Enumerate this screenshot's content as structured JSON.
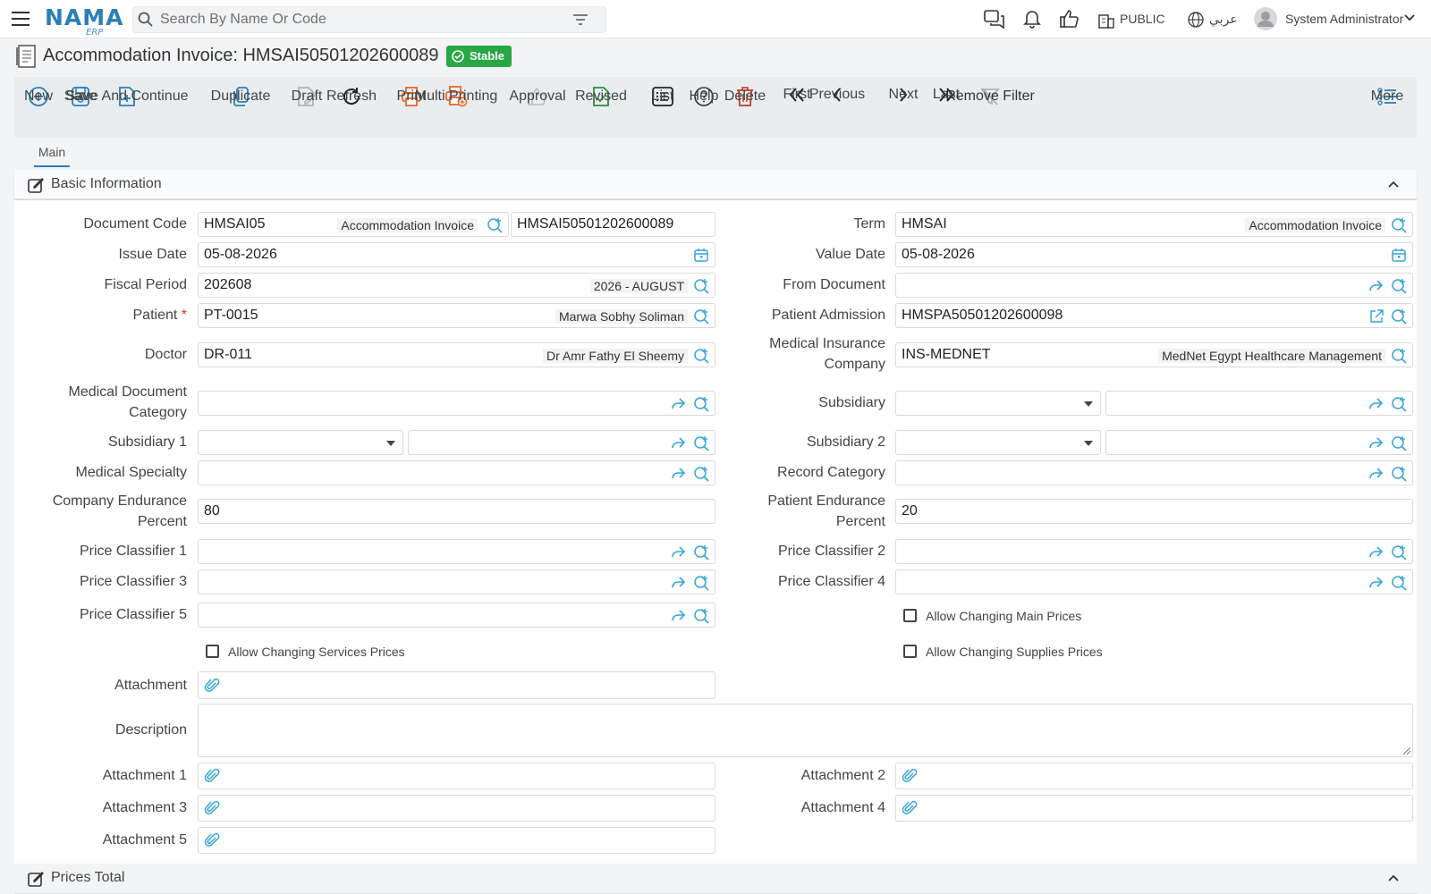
{
  "app": {
    "logo": "NAMA",
    "logo_sub": "ERP"
  },
  "search": {
    "placeholder": "Search By Name Or Code"
  },
  "header": {
    "branch": "PUBLIC",
    "language": "عربي",
    "user": "System Administrator"
  },
  "page": {
    "title": "Accommodation Invoice: HMSAI50501202600089",
    "status": "Stable"
  },
  "toolbar": {
    "new": "New",
    "save": "Save",
    "save_continue": "Save And Continue",
    "duplicate": "Duplicate",
    "draft": "Draft",
    "refresh": "Refresh",
    "print": "Print",
    "multi_printing": "Multi Printing",
    "approval": "Approval",
    "revised": "Revised",
    "list": "List",
    "help": "Help",
    "delete": "Delete",
    "first": "First",
    "previous": "Previous",
    "next": "Next",
    "last": "Last",
    "remove_filter": "Remove Filter",
    "more": "More"
  },
  "tabs": {
    "main": "Main"
  },
  "sections": {
    "basic": "Basic Information",
    "prices": "Prices Total"
  },
  "form": {
    "document_code": {
      "label": "Document Code",
      "value": "HMSAI05",
      "sub": "Accommodation Invoice",
      "number": "HMSAI50501202600089"
    },
    "term": {
      "label": "Term",
      "value": "HMSAI",
      "sub": "Accommodation Invoice"
    },
    "issue_date": {
      "label": "Issue Date",
      "value": "05-08-2026"
    },
    "value_date": {
      "label": "Value Date",
      "value": "05-08-2026"
    },
    "fiscal_period": {
      "label": "Fiscal Period",
      "value": "202608",
      "sub": "2026 - AUGUST"
    },
    "from_document": {
      "label": "From Document",
      "value": ""
    },
    "patient": {
      "label": "Patient",
      "value": "PT-0015",
      "sub": "Marwa Sobhy Soliman",
      "required": "*"
    },
    "patient_admission": {
      "label": "Patient Admission",
      "value": "HMSPA50501202600098"
    },
    "doctor": {
      "label": "Doctor",
      "value": "DR-011",
      "sub": "Dr Amr Fathy El Sheemy"
    },
    "insurance": {
      "label_1": "Medical Insurance",
      "label_2": "Company",
      "value": "INS-MEDNET",
      "sub": "MedNet Egypt Healthcare Management"
    },
    "med_doc_category": {
      "label_1": "Medical Document",
      "label_2": "Category",
      "value": ""
    },
    "subsidiary": {
      "label": "Subsidiary",
      "value": ""
    },
    "subsidiary_1": {
      "label": "Subsidiary 1",
      "value": ""
    },
    "subsidiary_2": {
      "label": "Subsidiary 2",
      "value": ""
    },
    "medical_specialty": {
      "label": "Medical Specialty",
      "value": ""
    },
    "record_category": {
      "label": "Record Category",
      "value": ""
    },
    "company_endurance": {
      "label_1": "Company Endurance",
      "label_2": "Percent",
      "value": "80"
    },
    "patient_endurance": {
      "label_1": "Patient Endurance",
      "label_2": "Percent",
      "value": "20"
    },
    "price_classifier_1": {
      "label": "Price Classifier 1",
      "value": ""
    },
    "price_classifier_2": {
      "label": "Price Classifier 2",
      "value": ""
    },
    "price_classifier_3": {
      "label": "Price Classifier 3",
      "value": ""
    },
    "price_classifier_4": {
      "label": "Price Classifier 4",
      "value": ""
    },
    "price_classifier_5": {
      "label": "Price Classifier 5",
      "value": ""
    },
    "allow_main_prices": {
      "label": "Allow Changing Main Prices",
      "checked": false
    },
    "allow_services_prices": {
      "label": "Allow Changing Services Prices",
      "checked": false
    },
    "allow_supplies_prices": {
      "label": "Allow Changing Supplies Prices",
      "checked": false
    },
    "attachment": {
      "label": "Attachment"
    },
    "description": {
      "label": "Description",
      "value": ""
    },
    "attachment_1": {
      "label": "Attachment 1"
    },
    "attachment_2": {
      "label": "Attachment 2"
    },
    "attachment_3": {
      "label": "Attachment 3"
    },
    "attachment_4": {
      "label": "Attachment 4"
    },
    "attachment_5": {
      "label": "Attachment 5"
    }
  },
  "colors": {
    "accent": "#2a7fb8",
    "stable": "#28a745",
    "print": "#e8672a",
    "delete": "#c0392b",
    "revised": "#2e8b3d"
  }
}
